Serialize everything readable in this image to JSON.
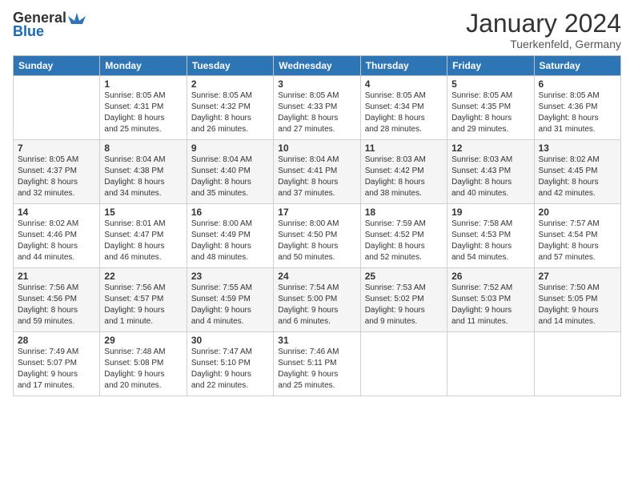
{
  "header": {
    "logo_general": "General",
    "logo_blue": "Blue",
    "title": "January 2024",
    "location": "Tuerkenfeld, Germany"
  },
  "days_of_week": [
    "Sunday",
    "Monday",
    "Tuesday",
    "Wednesday",
    "Thursday",
    "Friday",
    "Saturday"
  ],
  "weeks": [
    [
      {
        "day": "",
        "info": ""
      },
      {
        "day": "1",
        "info": "Sunrise: 8:05 AM\nSunset: 4:31 PM\nDaylight: 8 hours\nand 25 minutes."
      },
      {
        "day": "2",
        "info": "Sunrise: 8:05 AM\nSunset: 4:32 PM\nDaylight: 8 hours\nand 26 minutes."
      },
      {
        "day": "3",
        "info": "Sunrise: 8:05 AM\nSunset: 4:33 PM\nDaylight: 8 hours\nand 27 minutes."
      },
      {
        "day": "4",
        "info": "Sunrise: 8:05 AM\nSunset: 4:34 PM\nDaylight: 8 hours\nand 28 minutes."
      },
      {
        "day": "5",
        "info": "Sunrise: 8:05 AM\nSunset: 4:35 PM\nDaylight: 8 hours\nand 29 minutes."
      },
      {
        "day": "6",
        "info": "Sunrise: 8:05 AM\nSunset: 4:36 PM\nDaylight: 8 hours\nand 31 minutes."
      }
    ],
    [
      {
        "day": "7",
        "info": "Sunrise: 8:05 AM\nSunset: 4:37 PM\nDaylight: 8 hours\nand 32 minutes."
      },
      {
        "day": "8",
        "info": "Sunrise: 8:04 AM\nSunset: 4:38 PM\nDaylight: 8 hours\nand 34 minutes."
      },
      {
        "day": "9",
        "info": "Sunrise: 8:04 AM\nSunset: 4:40 PM\nDaylight: 8 hours\nand 35 minutes."
      },
      {
        "day": "10",
        "info": "Sunrise: 8:04 AM\nSunset: 4:41 PM\nDaylight: 8 hours\nand 37 minutes."
      },
      {
        "day": "11",
        "info": "Sunrise: 8:03 AM\nSunset: 4:42 PM\nDaylight: 8 hours\nand 38 minutes."
      },
      {
        "day": "12",
        "info": "Sunrise: 8:03 AM\nSunset: 4:43 PM\nDaylight: 8 hours\nand 40 minutes."
      },
      {
        "day": "13",
        "info": "Sunrise: 8:02 AM\nSunset: 4:45 PM\nDaylight: 8 hours\nand 42 minutes."
      }
    ],
    [
      {
        "day": "14",
        "info": "Sunrise: 8:02 AM\nSunset: 4:46 PM\nDaylight: 8 hours\nand 44 minutes."
      },
      {
        "day": "15",
        "info": "Sunrise: 8:01 AM\nSunset: 4:47 PM\nDaylight: 8 hours\nand 46 minutes."
      },
      {
        "day": "16",
        "info": "Sunrise: 8:00 AM\nSunset: 4:49 PM\nDaylight: 8 hours\nand 48 minutes."
      },
      {
        "day": "17",
        "info": "Sunrise: 8:00 AM\nSunset: 4:50 PM\nDaylight: 8 hours\nand 50 minutes."
      },
      {
        "day": "18",
        "info": "Sunrise: 7:59 AM\nSunset: 4:52 PM\nDaylight: 8 hours\nand 52 minutes."
      },
      {
        "day": "19",
        "info": "Sunrise: 7:58 AM\nSunset: 4:53 PM\nDaylight: 8 hours\nand 54 minutes."
      },
      {
        "day": "20",
        "info": "Sunrise: 7:57 AM\nSunset: 4:54 PM\nDaylight: 8 hours\nand 57 minutes."
      }
    ],
    [
      {
        "day": "21",
        "info": "Sunrise: 7:56 AM\nSunset: 4:56 PM\nDaylight: 8 hours\nand 59 minutes."
      },
      {
        "day": "22",
        "info": "Sunrise: 7:56 AM\nSunset: 4:57 PM\nDaylight: 9 hours\nand 1 minute."
      },
      {
        "day": "23",
        "info": "Sunrise: 7:55 AM\nSunset: 4:59 PM\nDaylight: 9 hours\nand 4 minutes."
      },
      {
        "day": "24",
        "info": "Sunrise: 7:54 AM\nSunset: 5:00 PM\nDaylight: 9 hours\nand 6 minutes."
      },
      {
        "day": "25",
        "info": "Sunrise: 7:53 AM\nSunset: 5:02 PM\nDaylight: 9 hours\nand 9 minutes."
      },
      {
        "day": "26",
        "info": "Sunrise: 7:52 AM\nSunset: 5:03 PM\nDaylight: 9 hours\nand 11 minutes."
      },
      {
        "day": "27",
        "info": "Sunrise: 7:50 AM\nSunset: 5:05 PM\nDaylight: 9 hours\nand 14 minutes."
      }
    ],
    [
      {
        "day": "28",
        "info": "Sunrise: 7:49 AM\nSunset: 5:07 PM\nDaylight: 9 hours\nand 17 minutes."
      },
      {
        "day": "29",
        "info": "Sunrise: 7:48 AM\nSunset: 5:08 PM\nDaylight: 9 hours\nand 20 minutes."
      },
      {
        "day": "30",
        "info": "Sunrise: 7:47 AM\nSunset: 5:10 PM\nDaylight: 9 hours\nand 22 minutes."
      },
      {
        "day": "31",
        "info": "Sunrise: 7:46 AM\nSunset: 5:11 PM\nDaylight: 9 hours\nand 25 minutes."
      },
      {
        "day": "",
        "info": ""
      },
      {
        "day": "",
        "info": ""
      },
      {
        "day": "",
        "info": ""
      }
    ]
  ]
}
